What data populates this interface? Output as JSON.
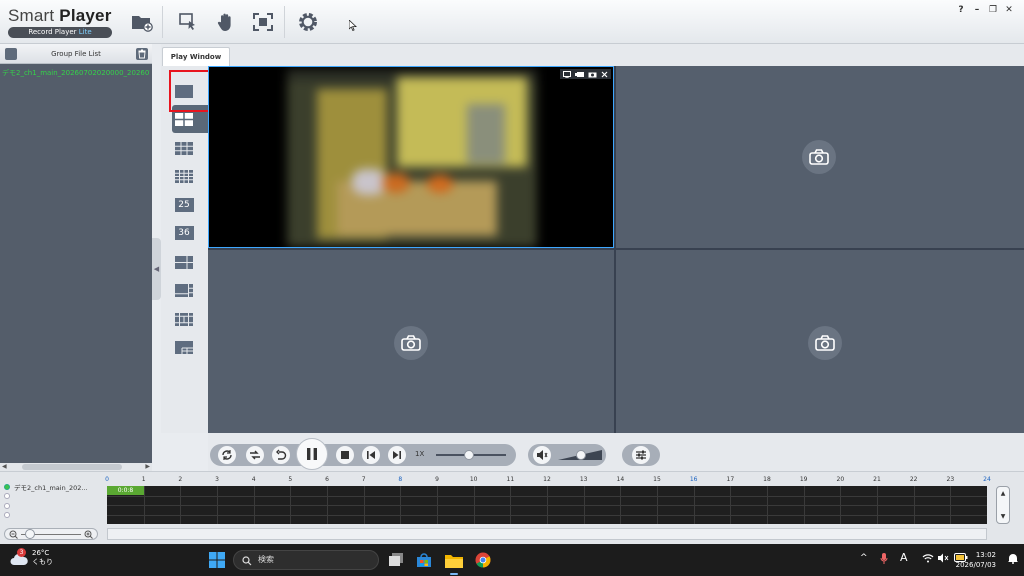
{
  "app": {
    "title_a": "Smart",
    "title_b": "Player",
    "subtitle_a": "Record Player",
    "subtitle_b": "Lite",
    "window_controls": [
      "?",
      "–",
      "❐",
      "✕"
    ]
  },
  "toolbar": {
    "icons": [
      "add-folder-icon",
      "select-window-icon",
      "hand-icon",
      "fullscreen-icon",
      "settings-icon"
    ]
  },
  "group_panel": {
    "header": "Group File List",
    "file": "デモ2_ch1_main_20260702020000_202607"
  },
  "tabs": {
    "play_window": "Play Window"
  },
  "layouts": {
    "labels": [
      "",
      "",
      "",
      "",
      "25",
      "36",
      "",
      "",
      "",
      ""
    ],
    "active_index": 1
  },
  "playback": {
    "speed": "1X"
  },
  "timeline": {
    "channels": [
      "デモ2_ch1_main_202...",
      "",
      "",
      ""
    ],
    "record_label": "0:0:8",
    "hours": [
      "0",
      "1",
      "2",
      "3",
      "4",
      "5",
      "6",
      "7",
      "8",
      "9",
      "10",
      "11",
      "12",
      "13",
      "14",
      "15",
      "16",
      "17",
      "18",
      "19",
      "20",
      "21",
      "22",
      "23",
      "24"
    ],
    "highlight_hours": [
      "0",
      "8",
      "16",
      "24"
    ]
  },
  "taskbar": {
    "weather_temp": "26°C",
    "weather_cond": "くもり",
    "weather_badge": "3",
    "search_placeholder": "検索",
    "time": "13:02",
    "date": "2026/07/03",
    "ime": "A"
  },
  "colors": {
    "accent_blue": "#3ea7ff",
    "highlight_red": "#e8141e",
    "file_green": "#35d14a",
    "record_green": "#5aa832"
  }
}
